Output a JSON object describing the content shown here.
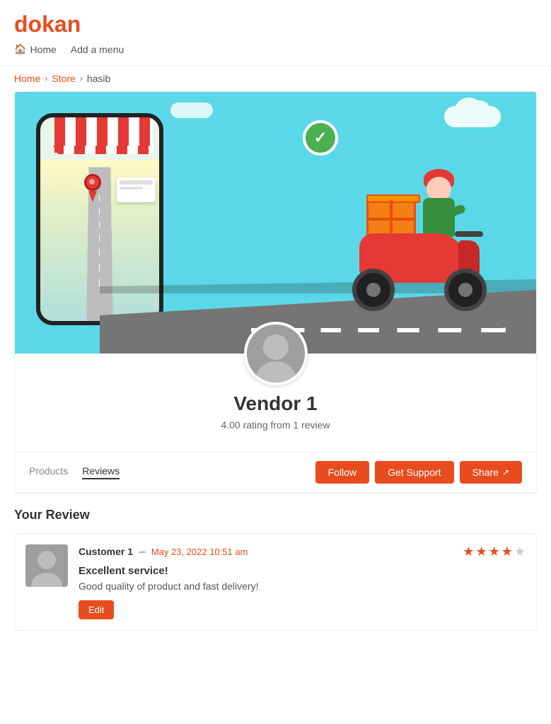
{
  "header": {
    "logo_d": "d",
    "logo_rest": "okan",
    "nav": [
      {
        "id": "home",
        "label": "Home",
        "icon": "🏠"
      },
      {
        "id": "add-menu",
        "label": "Add a menu",
        "icon": ""
      }
    ]
  },
  "breadcrumb": {
    "items": [
      {
        "label": "Home",
        "href": "#"
      },
      {
        "label": "Store",
        "href": "#"
      },
      {
        "label": "hasib",
        "href": ""
      }
    ]
  },
  "vendor": {
    "name": "Vendor 1",
    "rating_text": "4.00 rating from 1 review"
  },
  "tabs": [
    {
      "id": "products",
      "label": "Products",
      "active": false
    },
    {
      "id": "reviews",
      "label": "Reviews",
      "active": true
    }
  ],
  "actions": {
    "follow": "Follow",
    "get_support": "Get Support",
    "share": "Share"
  },
  "review_section": {
    "title": "Your Review",
    "review": {
      "customer_name": "Customer 1",
      "dash": "–",
      "date": "May 23, 2022 10:51 am",
      "stars": [
        true,
        true,
        true,
        true,
        false
      ],
      "headline": "Excellent service!",
      "body": "Good quality of product and fast delivery!",
      "edit_label": "Edit"
    }
  }
}
